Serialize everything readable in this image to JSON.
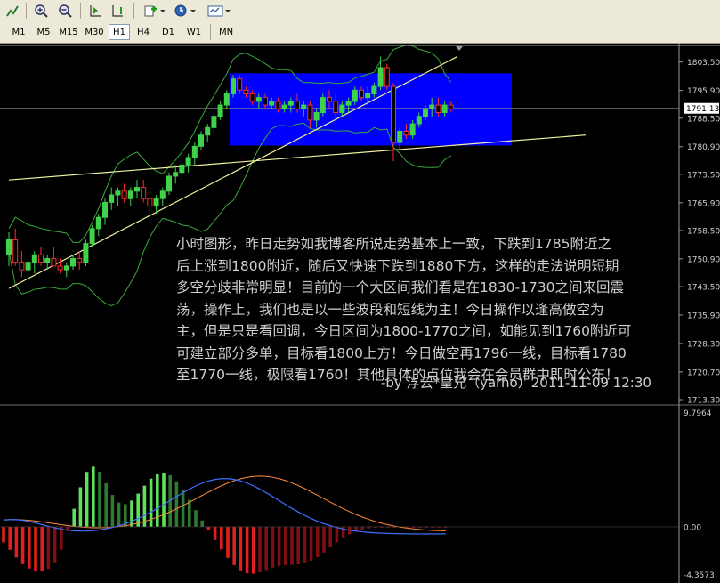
{
  "toolbar": {
    "icons": [
      "chart-line-icon",
      "zoom-in-icon",
      "zoom-out-icon",
      "autoscroll-icon",
      "chart-shift-icon",
      "indicators-icon",
      "period-clock-icon",
      "template-icon"
    ]
  },
  "timeframes": [
    "M1",
    "M5",
    "M15",
    "M30",
    "H1",
    "H4",
    "D1",
    "W1",
    "MN"
  ],
  "active_timeframe": "H1",
  "price_axis": {
    "labels": [
      "1803.50",
      "1795.90",
      "1788.50",
      "1780.90",
      "1773.50",
      "1765.90",
      "1758.50",
      "1750.90",
      "1743.50",
      "1735.90",
      "1728.30",
      "1720.70",
      "1713.30"
    ],
    "current_price": "1791.13"
  },
  "oscillator_axis": {
    "labels": [
      "9.7964",
      "0.00",
      "-4.3573"
    ]
  },
  "annotation": {
    "lines": [
      "小时图形，昨日走势如我博客所说走势基本上一致，下跌到1785附近之",
      "后上涨到1800附近，随后又快速下跌到1880下方，这样的走法说明短期",
      "多空分歧非常明显！目前的一个大区间我们看是在1830-1730之间来回震",
      "荡，操作上，我们也是以一些波段和短线为主！今日操作以逢高做空为",
      "主，但是只是看回调，今日区间为1800-1770之间，如能见到1760附近可",
      "可建立部分多单，目标看1800上方！今日做空再1796一线，目标看1780",
      "至1770一线，极限看1760！其他具体的点位我会在会员群中即时公布！"
    ],
    "signature": "-by 浮云*皇兄（yarho）2011-11-09 12:30"
  },
  "colors": {
    "bull": "#3fd24a",
    "bear": "#ff2a2a",
    "box": "#0000ff",
    "trendline": "#f2f2a0",
    "bands": "#3aa83a",
    "macd_main": "#3f6fff",
    "macd_signal": "#ff8c3a"
  },
  "chart_data": {
    "type": "candlestick",
    "y_range": [
      1713.3,
      1807.0
    ],
    "current_price": 1791.13,
    "candles": [
      [
        1752,
        1758,
        1749,
        1756
      ],
      [
        1756,
        1759,
        1749,
        1750
      ],
      [
        1750,
        1753,
        1746,
        1748
      ],
      [
        1748,
        1751,
        1745,
        1750
      ],
      [
        1750,
        1753,
        1747,
        1752
      ],
      [
        1752,
        1754,
        1749,
        1750
      ],
      [
        1750,
        1752,
        1748,
        1751
      ],
      [
        1751,
        1754,
        1749,
        1749
      ],
      [
        1749,
        1751,
        1747,
        1748
      ],
      [
        1748,
        1750,
        1746,
        1749
      ],
      [
        1749,
        1752,
        1748,
        1751
      ],
      [
        1751,
        1753,
        1748,
        1750
      ],
      [
        1750,
        1756,
        1749,
        1755
      ],
      [
        1755,
        1760,
        1754,
        1759
      ],
      [
        1759,
        1763,
        1757,
        1762
      ],
      [
        1762,
        1767,
        1760,
        1766
      ],
      [
        1766,
        1770,
        1764,
        1768
      ],
      [
        1768,
        1770,
        1765,
        1769
      ],
      [
        1769,
        1771,
        1766,
        1767
      ],
      [
        1767,
        1770,
        1765,
        1769
      ],
      [
        1769,
        1772,
        1767,
        1770
      ],
      [
        1770,
        1772,
        1766,
        1767
      ],
      [
        1767,
        1769,
        1763,
        1765
      ],
      [
        1765,
        1768,
        1763,
        1767
      ],
      [
        1767,
        1770,
        1765,
        1769
      ],
      [
        1769,
        1774,
        1768,
        1773
      ],
      [
        1773,
        1776,
        1771,
        1774
      ],
      [
        1774,
        1777,
        1772,
        1776
      ],
      [
        1776,
        1779,
        1774,
        1778
      ],
      [
        1778,
        1782,
        1776,
        1781
      ],
      [
        1781,
        1785,
        1780,
        1784
      ],
      [
        1784,
        1787,
        1782,
        1786
      ],
      [
        1786,
        1790,
        1784,
        1789
      ],
      [
        1789,
        1793,
        1788,
        1792
      ],
      [
        1792,
        1796,
        1791,
        1795
      ],
      [
        1795,
        1800,
        1794,
        1799
      ],
      [
        1799,
        1800,
        1795,
        1796
      ],
      [
        1796,
        1797,
        1794,
        1795
      ],
      [
        1795,
        1796,
        1792,
        1793
      ],
      [
        1793,
        1795,
        1791,
        1794
      ],
      [
        1794,
        1795,
        1791,
        1792
      ],
      [
        1792,
        1794,
        1791,
        1793
      ],
      [
        1793,
        1794,
        1790,
        1791
      ],
      [
        1791,
        1793,
        1790,
        1792
      ],
      [
        1792,
        1794,
        1790,
        1793
      ],
      [
        1793,
        1795,
        1790,
        1791
      ],
      [
        1791,
        1793,
        1789,
        1792
      ],
      [
        1792,
        1793,
        1786,
        1788
      ],
      [
        1788,
        1791,
        1786,
        1790
      ],
      [
        1790,
        1795,
        1789,
        1794
      ],
      [
        1794,
        1796,
        1791,
        1793
      ],
      [
        1793,
        1795,
        1788,
        1790
      ],
      [
        1790,
        1793,
        1789,
        1792
      ],
      [
        1792,
        1794,
        1790,
        1793
      ],
      [
        1793,
        1797,
        1792,
        1796
      ],
      [
        1796,
        1797,
        1793,
        1794
      ],
      [
        1794,
        1797,
        1792,
        1795
      ],
      [
        1795,
        1798,
        1794,
        1797
      ],
      [
        1797,
        1805,
        1796,
        1802
      ],
      [
        1802,
        1803,
        1796,
        1797
      ],
      [
        1797,
        1798,
        1777,
        1782
      ],
      [
        1782,
        1786,
        1780,
        1785
      ],
      [
        1785,
        1787,
        1783,
        1784
      ],
      [
        1784,
        1788,
        1783,
        1787
      ],
      [
        1787,
        1790,
        1786,
        1789
      ],
      [
        1789,
        1792,
        1788,
        1791
      ],
      [
        1791,
        1794,
        1789,
        1792
      ],
      [
        1792,
        1794,
        1789,
        1790
      ],
      [
        1790,
        1793,
        1789,
        1792
      ],
      [
        1792,
        1793,
        1790,
        1791
      ]
    ],
    "box": {
      "high": 1800.5,
      "low": 1781.2
    },
    "trendlines": [
      {
        "from": [
          0,
          1743
        ],
        "to": [
          70,
          1805
        ]
      },
      {
        "from": [
          0,
          1772
        ],
        "to": [
          90,
          1784
        ]
      }
    ]
  }
}
